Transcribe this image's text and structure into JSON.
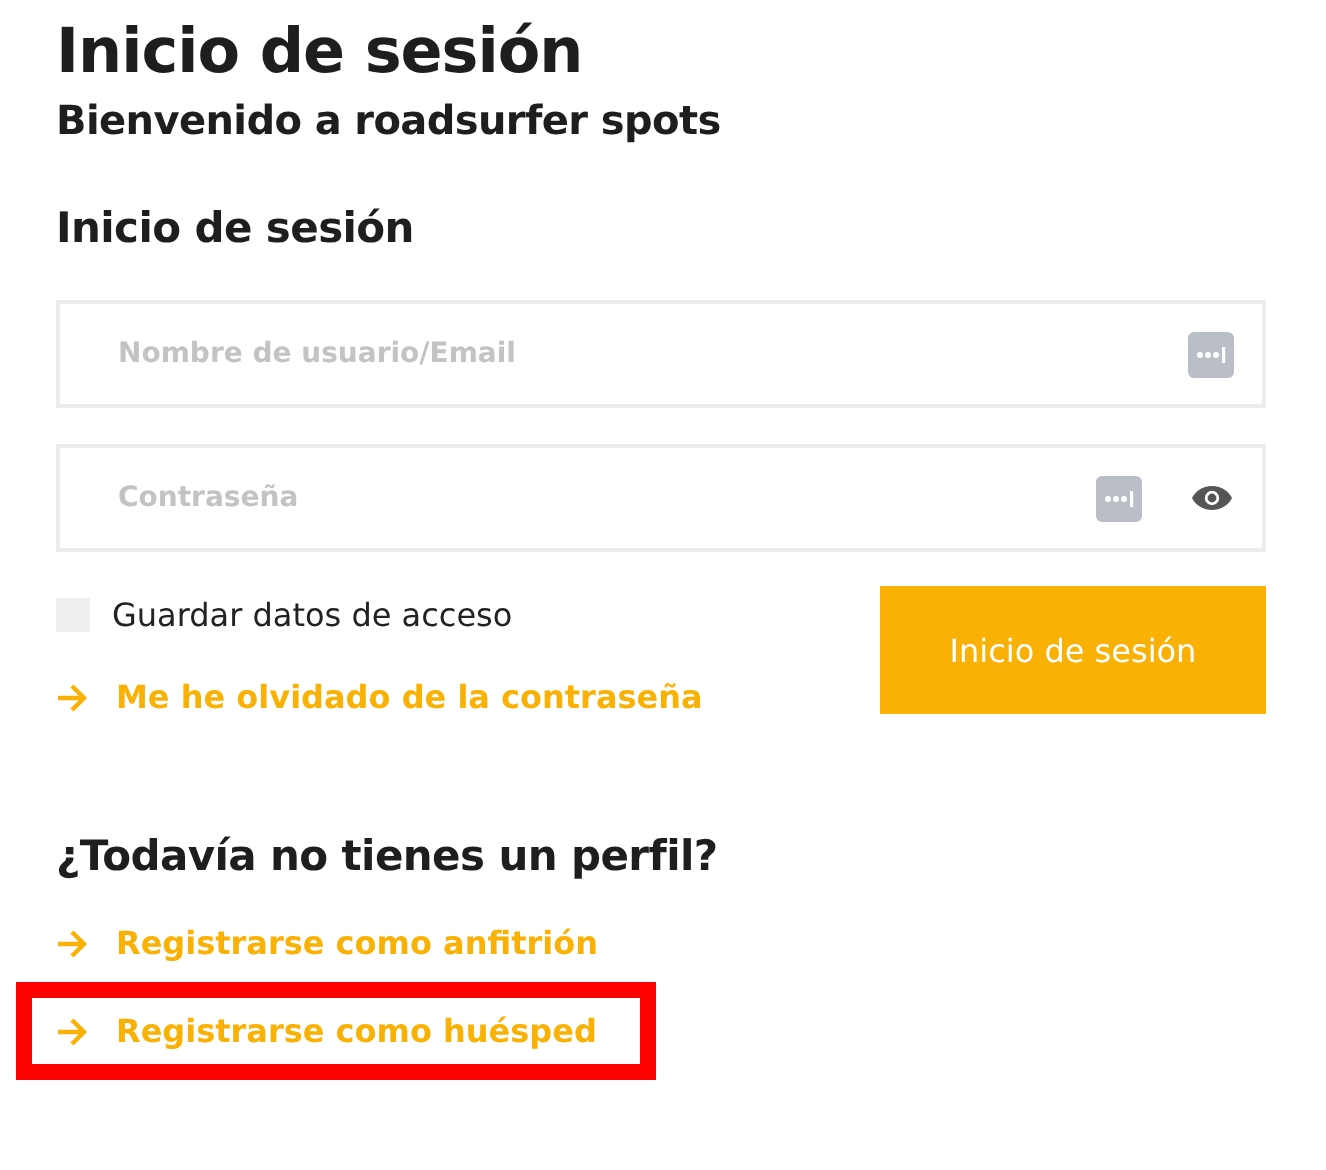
{
  "title": "Inicio de sesión",
  "subtitle": "Bienvenido a roadsurfer spots",
  "login": {
    "heading": "Inicio de sesión",
    "fields": [
      {
        "placeholder": "Nombre de usuario/Email",
        "kind": "text"
      },
      {
        "placeholder": "Contraseña",
        "kind": "password"
      }
    ],
    "remember": {
      "label": "Guardar datos de acceso",
      "checked": false
    },
    "submit": "Inicio de sesión",
    "forgot": {
      "label": "Me he olvidado de la contraseña",
      "highlighted": false
    }
  },
  "register": {
    "heading": "¿Todavía no tienes un perfil?",
    "links": [
      {
        "label": "Registrarse como anfitrión",
        "highlighted": false
      },
      {
        "label": "Registrarse como huésped",
        "highlighted": true
      }
    ]
  }
}
